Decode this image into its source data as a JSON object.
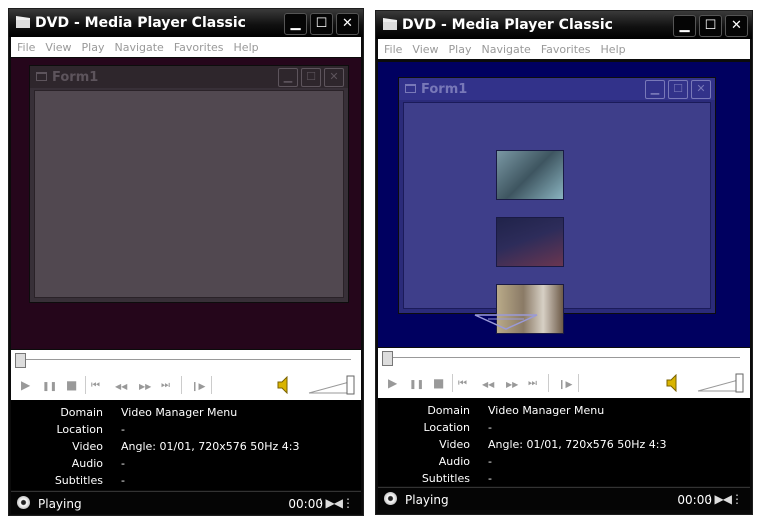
{
  "windows": [
    {
      "title": "DVD - Media Player Classic",
      "menu": [
        "File",
        "View",
        "Play",
        "Navigate",
        "Favorites",
        "Help"
      ],
      "form": {
        "title": "Form1"
      },
      "info": [
        {
          "label": "Domain",
          "value": "Video Manager Menu"
        },
        {
          "label": "Location",
          "value": "-"
        },
        {
          "label": "Video",
          "value": "Angle: 01/01, 720x576 50Hz 4:3"
        },
        {
          "label": "Audio",
          "value": "-"
        },
        {
          "label": "Subtitles",
          "value": "-"
        }
      ],
      "status": {
        "state": "Playing",
        "time": "00:00"
      }
    },
    {
      "title": "DVD - Media Player Classic",
      "menu": [
        "File",
        "View",
        "Play",
        "Navigate",
        "Favorites",
        "Help"
      ],
      "form": {
        "title": "Form1"
      },
      "info": [
        {
          "label": "Domain",
          "value": "Video Manager Menu"
        },
        {
          "label": "Location",
          "value": "-"
        },
        {
          "label": "Video",
          "value": "Angle: 01/01, 720x576 50Hz 4:3"
        },
        {
          "label": "Audio",
          "value": "-"
        },
        {
          "label": "Subtitles",
          "value": "-"
        }
      ],
      "status": {
        "state": "Playing",
        "time": "00:00"
      }
    }
  ],
  "icons": {
    "title_buttons": [
      "minimize-icon",
      "maximize-icon",
      "close-icon"
    ],
    "controls": [
      "play-icon",
      "pause-icon",
      "stop-icon",
      "previous-chapter-icon",
      "rewind-icon",
      "fast-forward-icon",
      "next-chapter-icon",
      "frame-step-icon",
      "speaker-icon"
    ],
    "glyphs": {
      "minimize": "▁",
      "maximize": "☐",
      "close": "✕",
      "play": "▶",
      "pause": "❚❚",
      "stop": "■",
      "prev": "⏮",
      "rew": "◀◀",
      "ff": "▶▶",
      "next": "⏭",
      "step": "❙▶",
      "speaker": "🔈",
      "ratio": "⋮▶◀⋮"
    }
  },
  "colors": {
    "video_bg_left": "#25061b",
    "video_bg_right": "#000060",
    "titlebar": "#000000"
  }
}
